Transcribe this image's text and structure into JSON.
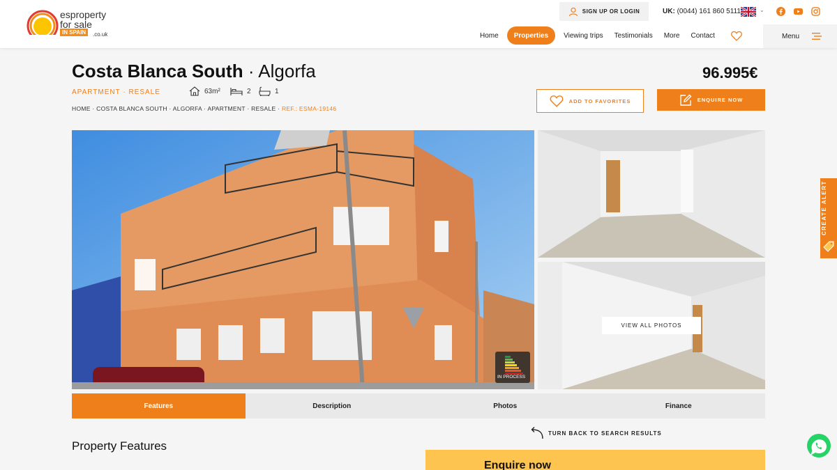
{
  "header": {
    "logo": {
      "line1": "esproperty",
      "line2": "for sale",
      "badge": "IN SPAIN",
      "suffix": ".co.uk"
    },
    "signup_label": "SIGN UP OR LOGIN",
    "phone_prefix": "UK:",
    "phone": "(0044) 161 860 5111",
    "nav": [
      "Home",
      "Properties",
      "Viewing trips",
      "Testimonials",
      "More",
      "Contact"
    ],
    "active_nav": "Properties",
    "menu_label": "Menu",
    "social_icons": [
      "facebook-icon",
      "youtube-icon",
      "instagram-icon"
    ]
  },
  "listing": {
    "title_bold": "Costa Blanca South",
    "title_sep": "·",
    "title_light": "Algorfa",
    "price": "96.995€",
    "type_label": "APARTMENT · RESALE",
    "area": "63m²",
    "bedrooms": "2",
    "bathrooms": "1",
    "breadcrumb": "HOME · COSTA BLANCA SOUTH · ALGORFA · APARTMENT · RESALE ·",
    "ref": "REF.: ESMA-19146",
    "add_favorites": "ADD TO FAVORITES",
    "enquire_now": "ENQUIRE NOW"
  },
  "gallery": {
    "view_all": "VIEW ALL PHOTOS",
    "energy_label": "IN PROCESS"
  },
  "tabs": [
    "Features",
    "Description",
    "Photos",
    "Finance"
  ],
  "active_tab": "Features",
  "back_link": "TURN BACK TO SEARCH RESULTS",
  "section_title": "Property Features",
  "enquire_box_title": "Enquire now",
  "alert_tab": "CREATE ALERT",
  "colors": {
    "accent": "#ef7f1a",
    "enquire_bg": "#fdc44f"
  }
}
